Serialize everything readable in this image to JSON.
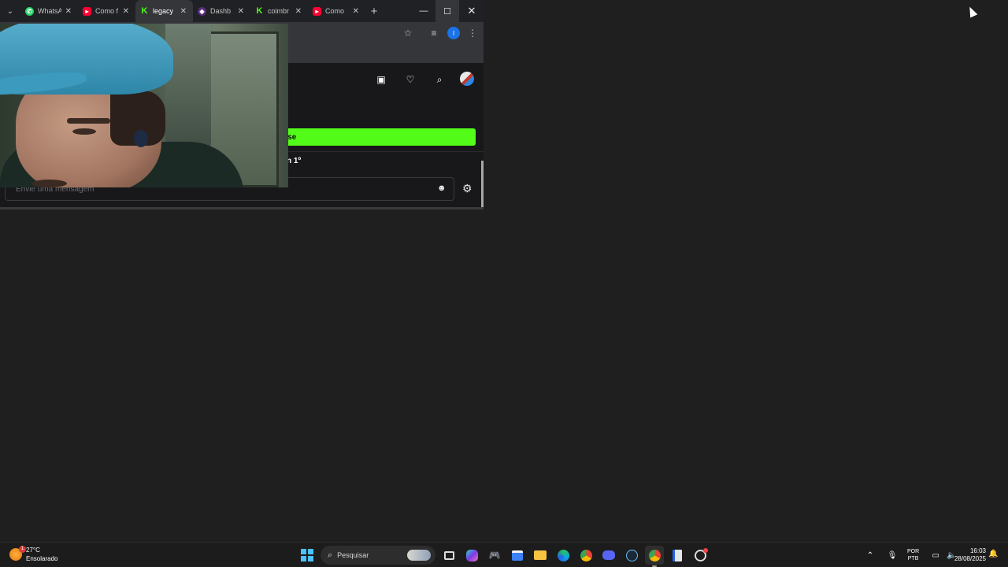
{
  "browser": {
    "tabs": [
      {
        "label": "WhatsA",
        "icon": "whatsapp-icon",
        "color": "#25d366"
      },
      {
        "label": "Como f",
        "icon": "youtube-icon",
        "color": "#ff0033"
      },
      {
        "label": "legacy",
        "icon": "kick-icon",
        "color": "#53fc18",
        "active": true
      },
      {
        "label": "Dashb",
        "icon": "dashboard-icon",
        "color": "#8e44ad"
      },
      {
        "label": "coimbr",
        "icon": "kick-icon",
        "color": "#53fc18"
      },
      {
        "label": "Como",
        "icon": "youtube-icon",
        "color": "#ff0033"
      }
    ],
    "profile_initial": "I"
  },
  "page": {
    "green_button_label": "r-se",
    "rank_text": "n 1º",
    "chat_placeholder": "Envie uma mensagem"
  },
  "taskbar": {
    "weather_temp": "27°C",
    "weather_desc": "Ensolarado",
    "weather_badge": "1",
    "search_label": "Pesquisar",
    "lang_line1": "POR",
    "lang_line2": "PTB",
    "time": "16:03",
    "date": "28/08/2025"
  }
}
